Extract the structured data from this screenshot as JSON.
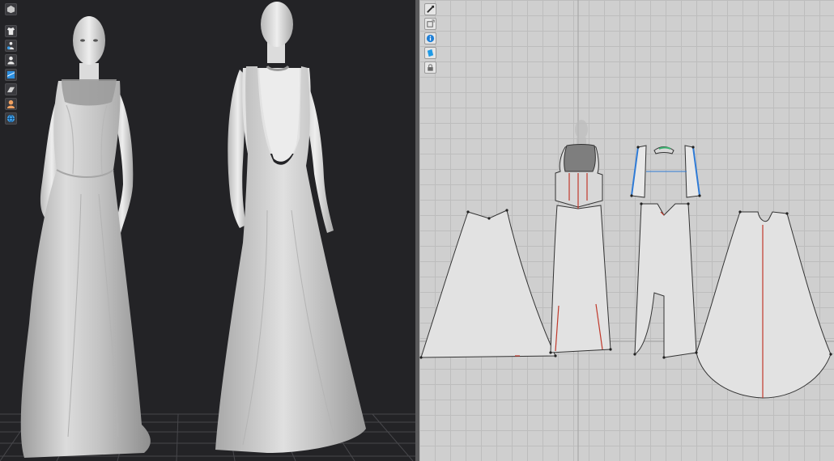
{
  "viewport_3d": {
    "toolbar": [
      {
        "name": "render-mode-icon",
        "color": "#c8c8c8"
      },
      {
        "name": "garment-icon",
        "color": "#e8e8e8"
      },
      {
        "name": "avatar-arrangement-icon",
        "color": "#3fa0e8"
      },
      {
        "name": "avatar-icon",
        "color": "#e8e8e8"
      },
      {
        "name": "texture-icon",
        "color": "#2d8fe0"
      },
      {
        "name": "fabric-icon",
        "color": "#cfcfcf"
      },
      {
        "name": "skin-icon",
        "color": "#f0a060"
      },
      {
        "name": "globe-icon",
        "color": "#3fa0e8"
      }
    ],
    "colors": {
      "background": "#232326",
      "floor_grid": "#46464a",
      "fabric": "#d2d2d2",
      "mesh": "#8a8a8a"
    }
  },
  "viewport_2d": {
    "toolbar": [
      {
        "name": "pattern-tool-icon",
        "color": "#2b2b2b"
      },
      {
        "name": "transform-tool-icon",
        "color": "#5a5a5a"
      },
      {
        "name": "info-icon",
        "color": "#1f7fd6"
      },
      {
        "name": "fabric-view-icon",
        "color": "#1f9ae6"
      },
      {
        "name": "lock-icon",
        "color": "#6b6b6b"
      }
    ],
    "colors": {
      "background": "#cfcfcf",
      "pattern_fill": "#e2e2e2",
      "outline": "#333333",
      "seam_red": "#c0392b",
      "seam_blue": "#2f7bd6"
    }
  }
}
